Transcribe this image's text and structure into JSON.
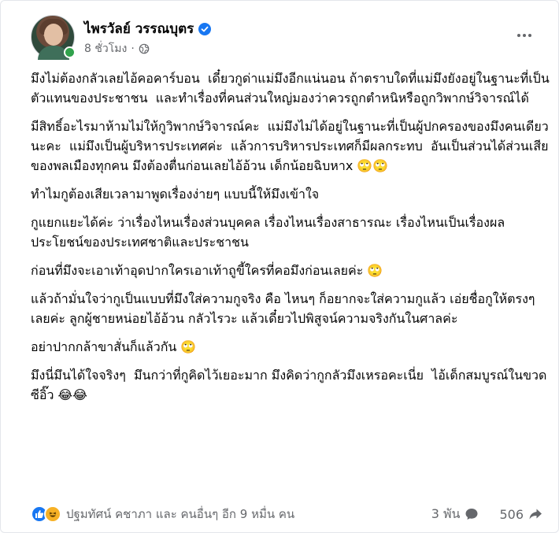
{
  "post": {
    "author": "ไพรวัลย์ วรรณบุตร",
    "time": "8 ชั่วโมง",
    "separator": "·",
    "paragraphs": [
      "มึงไม่ต้องกลัวเลยไอ้คอคาร์บอน ￼ เดี๋ยวกูด่าแม่มึงอีกแน่นอน ถ้าตราบใดที่แม่มึงยังอยู่ในฐานะที่เป็นตัวแทนของประชาชน ￼ และทำเรื่องที่คนส่วนใหญ่มองว่าควรถูกตำหนิหรือถูกวิพากษ์วิจารณ์ได้",
      "￼มีสิทธิ์อะไรมาห้ามไม่ให้กูวิพากษ์วิจารณ์คะ ￼ แม่มึงไม่ได้อยู่ในฐานะที่เป็นผู้ปกครองของมึงคนเดียวนะคะ ￼ แม่มึงเป็นผู้บริหารประเทศค่ะ ￼ แล้วการบริหารประเทศก็มีผลกระทบ ￼ อันเป็นส่วนได้ส่วนเสียของพลเมืองทุกคน มึงต้องตื่นก่อนเลยไอ้อ้วน ￼เด็กน้อยฉิบหาx 🙄🙄",
      "ทำไมกูต้องเสียเวลามาพูดเรื่องง่ายๆ แบบนี้ให้มึงเข้าใจ",
      "กูแยกแยะได้ค่ะ ว่าเรื่องไหนเรื่องส่วนบุคคล เรื่องไหนเรื่องสาธารณะ เรื่องไหนเป็นเรื่องผลประโยชน์ของประเทศชาติและประชาชน",
      "ก่อนที่มึงจะเอาเท้าอุดปากใครเอาเท้าถูขี้ใครที่คอมึงก่อนเลยค่ะ 🙄",
      "แล้วถ้ามั่นใจว่ากูเป็นแบบที่มึงใส่ความกูจริง คือ ไหนๆ ก็อยากจะใส่ความกูแล้ว เอ่ยชื่อกูให้ตรงๆ เลยค่ะ ลูกผู้ชายหน่อยไอ้อ้วน ￼กลัวไรวะ แล้วเดี๋ยวไปพิสูจน์ความจริงกันในศาลค่ะ",
      "อย่าปากกล้าขาสั่นก็แล้วกัน 🙄",
      "มึงนี่มึนได้ใจจริงๆ ￼ มึนกว่าที่กูคิดไว้เยอะมาก มึงคิดว่ากูกลัวมึงเหรอคะเนี่ย ￼ ไอ้เด็กสมบูรณ์ในขวดซีอิ๊ว 😂😂"
    ],
    "reactions_text": "ปฐมทัศน์ คชาภา และ คนอื่นๆ อีก 9 หมื่น คน",
    "comments_count": "3 พัน",
    "shares_count": "506"
  },
  "icons": {
    "verified": "verified-check-icon",
    "globe": "globe-icon",
    "more": "more-options-icon",
    "like": "like-reaction-icon",
    "haha": "haha-reaction-icon",
    "comment": "comment-icon",
    "share": "share-icon"
  },
  "colors": {
    "accent": "#1877f2",
    "secondary_text": "#65676b",
    "online": "#31a24c"
  }
}
